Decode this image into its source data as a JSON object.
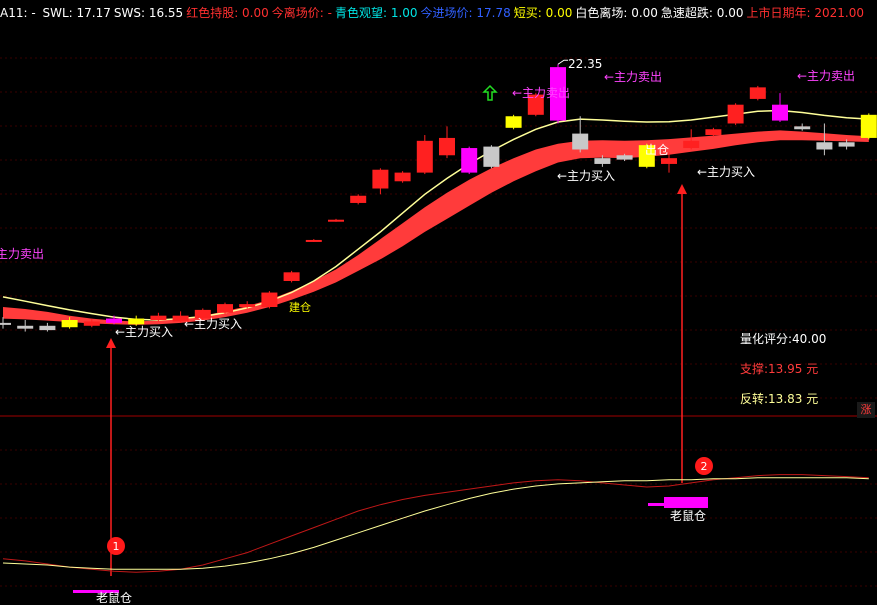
{
  "header": {
    "items": [
      {
        "text": "A11: - ",
        "color": "#ffffff"
      },
      {
        "text": "SWL: 17.17",
        "color": "#ffffff"
      },
      {
        "text": "SWS: 16.55",
        "color": "#ffffff"
      },
      {
        "text": "红色持股: 0.00",
        "color": "#ff3030"
      },
      {
        "text": "今离场价: -",
        "color": "#ff3030"
      },
      {
        "text": "青色观望: 1.00",
        "color": "#00e5e5"
      },
      {
        "text": "今进场价: 17.78",
        "color": "#3060ff"
      },
      {
        "text": "短买: 0.00",
        "color": "#ffff00"
      },
      {
        "text": "白色离场: 0.00",
        "color": "#ffffff"
      },
      {
        "text": "急速超跌: 0.00",
        "color": "#ffffff"
      },
      {
        "text": "上市日期年: 2021.00",
        "color": "#ff3030"
      }
    ]
  },
  "info": {
    "score": "量化评分:40.00",
    "support": "支撑:13.95 元",
    "reversal": "反转:13.83 元"
  },
  "corner_label": "涨",
  "annotations": {
    "high_price": "22.35",
    "sell_label": "←主力卖出",
    "buy_label": "←主力买入",
    "out_label": "出仓",
    "jian_label": "建仓",
    "mouse_label": "老鼠仓",
    "marker1": "1",
    "marker2": "2"
  },
  "colors": {
    "up": "#ff2020",
    "band": "#ff3b3b",
    "yellow": "#ffff00",
    "magenta": "#ff00ff",
    "gray": "#c8c8c8",
    "white_line": "#ffff99",
    "red_line": "#c01818",
    "grid": "#3a0000",
    "sell_text": "#ff44ff",
    "buy_text": "#ffffff"
  },
  "chart_data": {
    "type": "candlestick",
    "note": "K线主图与副图指标（价格按图形估读）",
    "candles": [
      {
        "i": 0,
        "o": 13.35,
        "c": 13.4,
        "h": 13.6,
        "l": 13.2,
        "color": "gray"
      },
      {
        "i": 1,
        "o": 13.2,
        "c": 13.3,
        "h": 13.5,
        "l": 13.1,
        "color": "gray"
      },
      {
        "i": 2,
        "o": 13.15,
        "c": 13.3,
        "h": 13.4,
        "l": 13.1,
        "color": "gray"
      },
      {
        "i": 3,
        "o": 13.25,
        "c": 13.5,
        "h": 13.6,
        "l": 13.2,
        "color": "yellow"
      },
      {
        "i": 4,
        "o": 13.3,
        "c": 13.45,
        "h": 13.55,
        "l": 13.25,
        "color": "red"
      },
      {
        "i": 5,
        "o": 13.4,
        "c": 13.55,
        "h": 13.65,
        "l": 13.35,
        "color": "magenta"
      },
      {
        "i": 6,
        "o": 13.35,
        "c": 13.55,
        "h": 13.65,
        "l": 13.3,
        "color": "yellow"
      },
      {
        "i": 7,
        "o": 13.5,
        "c": 13.65,
        "h": 13.75,
        "l": 13.45,
        "color": "red"
      },
      {
        "i": 8,
        "o": 13.45,
        "c": 13.65,
        "h": 13.8,
        "l": 13.4,
        "color": "red"
      },
      {
        "i": 9,
        "o": 13.55,
        "c": 13.85,
        "h": 13.9,
        "l": 13.5,
        "color": "red"
      },
      {
        "i": 10,
        "o": 13.75,
        "c": 14.05,
        "h": 14.1,
        "l": 13.7,
        "color": "red"
      },
      {
        "i": 11,
        "o": 13.95,
        "c": 14.05,
        "h": 14.15,
        "l": 13.9,
        "color": "red"
      },
      {
        "i": 12,
        "o": 13.95,
        "c": 14.45,
        "h": 14.5,
        "l": 13.9,
        "color": "red"
      },
      {
        "i": 13,
        "o": 14.85,
        "c": 15.15,
        "h": 15.2,
        "l": 14.8,
        "color": "red"
      },
      {
        "i": 14,
        "o": 16.25,
        "c": 16.27,
        "h": 16.3,
        "l": 16.2,
        "color": "red"
      },
      {
        "i": 15,
        "o": 16.95,
        "c": 16.97,
        "h": 17.0,
        "l": 16.9,
        "color": "red"
      },
      {
        "i": 16,
        "o": 17.55,
        "c": 17.8,
        "h": 17.85,
        "l": 17.5,
        "color": "red"
      },
      {
        "i": 17,
        "o": 18.05,
        "c": 18.7,
        "h": 18.75,
        "l": 17.85,
        "color": "red"
      },
      {
        "i": 18,
        "o": 18.3,
        "c": 18.6,
        "h": 18.65,
        "l": 18.25,
        "color": "red"
      },
      {
        "i": 19,
        "o": 18.6,
        "c": 19.7,
        "h": 19.9,
        "l": 18.55,
        "color": "red"
      },
      {
        "i": 20,
        "o": 19.2,
        "c": 19.8,
        "h": 20.2,
        "l": 19.1,
        "color": "red"
      },
      {
        "i": 21,
        "o": 18.6,
        "c": 19.45,
        "h": 19.5,
        "l": 18.55,
        "color": "magenta"
      },
      {
        "i": 22,
        "o": 18.8,
        "c": 19.5,
        "h": 19.55,
        "l": 18.75,
        "color": "gray"
      },
      {
        "i": 23,
        "o": 20.15,
        "c": 20.55,
        "h": 20.6,
        "l": 20.1,
        "color": "yellow"
      },
      {
        "i": 24,
        "o": 20.6,
        "c": 21.3,
        "h": 21.35,
        "l": 20.55,
        "color": "red"
      },
      {
        "i": 25,
        "o": 20.4,
        "c": 22.25,
        "h": 22.35,
        "l": 20.3,
        "color": "magenta"
      },
      {
        "i": 26,
        "o": 19.4,
        "c": 19.95,
        "h": 20.55,
        "l": 19.3,
        "color": "gray"
      },
      {
        "i": 27,
        "o": 18.9,
        "c": 19.1,
        "h": 19.2,
        "l": 18.8,
        "color": "gray"
      },
      {
        "i": 28,
        "o": 19.05,
        "c": 19.2,
        "h": 19.25,
        "l": 19.0,
        "color": "gray"
      },
      {
        "i": 29,
        "o": 18.8,
        "c": 19.55,
        "h": 19.6,
        "l": 18.75,
        "color": "yellow"
      },
      {
        "i": 30,
        "o": 18.9,
        "c": 19.1,
        "h": 19.3,
        "l": 18.6,
        "color": "red"
      },
      {
        "i": 31,
        "o": 19.45,
        "c": 19.7,
        "h": 20.1,
        "l": 19.4,
        "color": "red"
      },
      {
        "i": 32,
        "o": 19.9,
        "c": 20.1,
        "h": 20.15,
        "l": 19.85,
        "color": "red"
      },
      {
        "i": 33,
        "o": 20.3,
        "c": 20.95,
        "h": 21.0,
        "l": 20.25,
        "color": "red"
      },
      {
        "i": 34,
        "o": 21.15,
        "c": 21.55,
        "h": 21.6,
        "l": 21.1,
        "color": "red"
      },
      {
        "i": 35,
        "o": 20.4,
        "c": 20.95,
        "h": 21.35,
        "l": 20.35,
        "color": "magenta"
      },
      {
        "i": 36,
        "o": 20.1,
        "c": 20.2,
        "h": 20.3,
        "l": 20.05,
        "color": "gray"
      },
      {
        "i": 37,
        "o": 19.4,
        "c": 19.65,
        "h": 20.3,
        "l": 19.2,
        "color": "gray"
      },
      {
        "i": 38,
        "o": 19.5,
        "c": 19.65,
        "h": 19.75,
        "l": 19.4,
        "color": "gray"
      },
      {
        "i": 39,
        "o": 19.8,
        "c": 20.6,
        "h": 20.65,
        "l": 19.75,
        "color": "yellow"
      }
    ],
    "band_top": [
      13.95,
      13.88,
      13.78,
      13.65,
      13.55,
      13.48,
      13.45,
      13.48,
      13.55,
      13.65,
      13.8,
      13.98,
      14.2,
      14.5,
      14.85,
      15.25,
      15.75,
      16.3,
      16.85,
      17.4,
      17.9,
      18.35,
      18.75,
      19.1,
      19.4,
      19.6,
      19.7,
      19.72,
      19.7,
      19.72,
      19.76,
      19.82,
      19.88,
      19.95,
      20.02,
      20.06,
      20.02,
      19.96,
      19.9,
      19.86
    ],
    "band_bot": [
      13.55,
      13.52,
      13.48,
      13.43,
      13.38,
      13.35,
      13.33,
      13.35,
      13.4,
      13.48,
      13.6,
      13.75,
      13.95,
      14.2,
      14.48,
      14.8,
      15.2,
      15.6,
      16.05,
      16.55,
      17.0,
      17.45,
      17.9,
      18.3,
      18.65,
      18.95,
      19.1,
      19.12,
      19.1,
      19.15,
      19.22,
      19.32,
      19.42,
      19.55,
      19.65,
      19.72,
      19.72,
      19.7,
      19.68,
      19.66
    ],
    "yellow_line": [
      14.3,
      14.15,
      14.0,
      13.85,
      13.72,
      13.6,
      13.52,
      13.5,
      13.55,
      13.62,
      13.75,
      13.92,
      14.15,
      14.45,
      14.85,
      15.35,
      15.95,
      16.55,
      17.2,
      17.85,
      18.4,
      18.9,
      19.35,
      19.75,
      20.1,
      20.35,
      20.45,
      20.42,
      20.38,
      20.35,
      20.36,
      20.42,
      20.52,
      20.62,
      20.72,
      20.75,
      20.68,
      20.58,
      20.5,
      20.45
    ],
    "indicator_red": [
      30,
      28,
      25,
      22,
      20,
      18,
      17,
      18,
      20,
      24,
      30,
      36,
      44,
      52,
      60,
      68,
      76,
      82,
      87,
      91,
      94,
      97,
      100,
      103,
      105,
      106,
      105,
      103,
      101,
      99,
      100,
      103,
      106,
      108,
      110,
      111,
      111,
      110,
      109,
      108
    ],
    "indicator_white": [
      26,
      25,
      24,
      22,
      21,
      20,
      20,
      20,
      20,
      21,
      23,
      26,
      30,
      35,
      41,
      48,
      55,
      62,
      69,
      76,
      82,
      88,
      93,
      97,
      100,
      102,
      103,
      104,
      105,
      105,
      106,
      106,
      107,
      107,
      108,
      108,
      108,
      108,
      108,
      107
    ]
  }
}
